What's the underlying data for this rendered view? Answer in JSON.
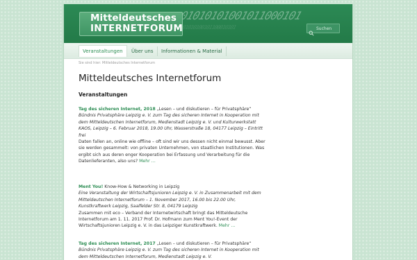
{
  "header": {
    "logo_line1": "Mitteldeutsches",
    "logo_line2": "INTERNETFORUM",
    "binary_text": "01010101001011000101",
    "search_placeholder": "Suchen"
  },
  "nav": {
    "items": [
      {
        "label": "Veranstaltungen",
        "active": true
      },
      {
        "label": "Über uns",
        "active": false
      },
      {
        "label": "Informationen & Material",
        "active": false
      }
    ]
  },
  "breadcrumb": "Sie sind hier: Mitteldeutsches Internetforum",
  "page_title": "Mitteldeutsches Internetforum",
  "section_title": "Veranstaltungen",
  "posts": [
    {
      "title": "Tag des sicheren Internet, 2018",
      "subtitle": " „Lesen – und diskutieren – für Privatsphäre“",
      "meta": "Bündnis Privatsphäre Leipzig e. V. zum Tag des sicheren Internet in Kooperation mit dem Mitteldeutschen Internetforum, Medienstadt Leipzig e. V. und Kulturwerkstatt KAOS, Leipzig – 6. Februar 2018, 19.00 Uhr, Wasserstraße 18, 04177 Leipzig – Eintritt frei",
      "body": "Daten fallen an, online wie offline – oft sind wir uns dessen nicht einmal bewusst. Aber sie werden gesammelt: von privaten Unternehmen, von staatlichen Institutionen. Was ergibt sich aus deren enger Kooperation bei Erfassung und Verarbeitung für die Datenlieferanten, also uns?",
      "more": "Mehr …"
    },
    {
      "title": "Ment You!",
      "subtitle": " Know-How & Networking in Leipzig",
      "meta": "Eine Veranstaltung der Wirtschaftsjunioren Leipzig e. V. in Zusammenarbeit mit dem Mitteldeutschen Internetforum – 1. November 2017, 16.00 bis 22.00 Uhr, Kunstkraftwerk Leipzig, Saalfelder Str. 8, 04179 Leipzig",
      "body": "Zusammen mit eco – Verband der Internetwirtschaft bringt das Mitteldeutsche Internetforum am 1. 11. 2017 Prof. Dr. Hofmann zum Ment You!-Event der Wirtschaftsjunioren Leipzig e. V. in das Leipziger Kunstkraftwerk.",
      "more": "Mehr …"
    },
    {
      "title": "Tag des sicheren Internet, 2017",
      "subtitle": " „Lesen – und diskutieren – für Privatsphäre“",
      "meta": "Bündnis Privatsphäre Leipzig e. V. zum Tag des sicheren Internet in Kooperation mit dem Mitteldeutschen Internetforum, Medienstadt Leipzig e. V.",
      "body": "",
      "more": ""
    }
  ],
  "colors": {
    "accent": "#2b8c52",
    "header_bg": "#2c8a55",
    "body_bg": "#c9e4d2"
  }
}
